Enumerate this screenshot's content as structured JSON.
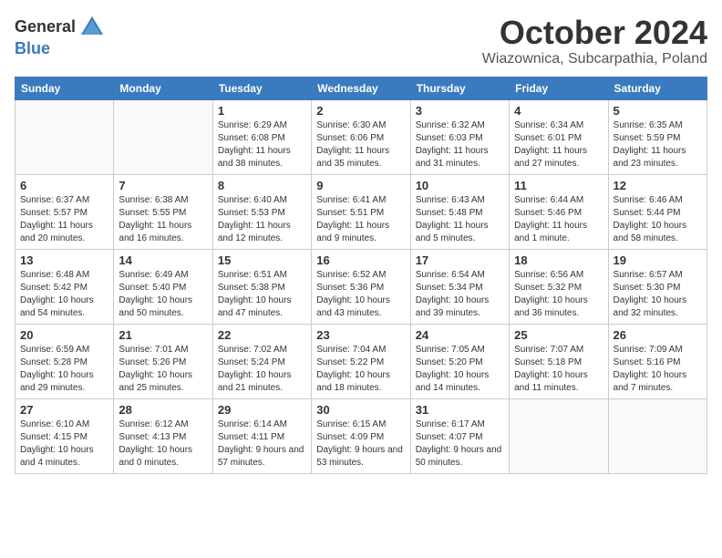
{
  "header": {
    "logo_general": "General",
    "logo_blue": "Blue",
    "month": "October 2024",
    "location": "Wiazownica, Subcarpathia, Poland"
  },
  "days_of_week": [
    "Sunday",
    "Monday",
    "Tuesday",
    "Wednesday",
    "Thursday",
    "Friday",
    "Saturday"
  ],
  "weeks": [
    [
      {
        "day": "",
        "info": ""
      },
      {
        "day": "",
        "info": ""
      },
      {
        "day": "1",
        "info": "Sunrise: 6:29 AM\nSunset: 6:08 PM\nDaylight: 11 hours and 38 minutes."
      },
      {
        "day": "2",
        "info": "Sunrise: 6:30 AM\nSunset: 6:06 PM\nDaylight: 11 hours and 35 minutes."
      },
      {
        "day": "3",
        "info": "Sunrise: 6:32 AM\nSunset: 6:03 PM\nDaylight: 11 hours and 31 minutes."
      },
      {
        "day": "4",
        "info": "Sunrise: 6:34 AM\nSunset: 6:01 PM\nDaylight: 11 hours and 27 minutes."
      },
      {
        "day": "5",
        "info": "Sunrise: 6:35 AM\nSunset: 5:59 PM\nDaylight: 11 hours and 23 minutes."
      }
    ],
    [
      {
        "day": "6",
        "info": "Sunrise: 6:37 AM\nSunset: 5:57 PM\nDaylight: 11 hours and 20 minutes."
      },
      {
        "day": "7",
        "info": "Sunrise: 6:38 AM\nSunset: 5:55 PM\nDaylight: 11 hours and 16 minutes."
      },
      {
        "day": "8",
        "info": "Sunrise: 6:40 AM\nSunset: 5:53 PM\nDaylight: 11 hours and 12 minutes."
      },
      {
        "day": "9",
        "info": "Sunrise: 6:41 AM\nSunset: 5:51 PM\nDaylight: 11 hours and 9 minutes."
      },
      {
        "day": "10",
        "info": "Sunrise: 6:43 AM\nSunset: 5:48 PM\nDaylight: 11 hours and 5 minutes."
      },
      {
        "day": "11",
        "info": "Sunrise: 6:44 AM\nSunset: 5:46 PM\nDaylight: 11 hours and 1 minute."
      },
      {
        "day": "12",
        "info": "Sunrise: 6:46 AM\nSunset: 5:44 PM\nDaylight: 10 hours and 58 minutes."
      }
    ],
    [
      {
        "day": "13",
        "info": "Sunrise: 6:48 AM\nSunset: 5:42 PM\nDaylight: 10 hours and 54 minutes."
      },
      {
        "day": "14",
        "info": "Sunrise: 6:49 AM\nSunset: 5:40 PM\nDaylight: 10 hours and 50 minutes."
      },
      {
        "day": "15",
        "info": "Sunrise: 6:51 AM\nSunset: 5:38 PM\nDaylight: 10 hours and 47 minutes."
      },
      {
        "day": "16",
        "info": "Sunrise: 6:52 AM\nSunset: 5:36 PM\nDaylight: 10 hours and 43 minutes."
      },
      {
        "day": "17",
        "info": "Sunrise: 6:54 AM\nSunset: 5:34 PM\nDaylight: 10 hours and 39 minutes."
      },
      {
        "day": "18",
        "info": "Sunrise: 6:56 AM\nSunset: 5:32 PM\nDaylight: 10 hours and 36 minutes."
      },
      {
        "day": "19",
        "info": "Sunrise: 6:57 AM\nSunset: 5:30 PM\nDaylight: 10 hours and 32 minutes."
      }
    ],
    [
      {
        "day": "20",
        "info": "Sunrise: 6:59 AM\nSunset: 5:28 PM\nDaylight: 10 hours and 29 minutes."
      },
      {
        "day": "21",
        "info": "Sunrise: 7:01 AM\nSunset: 5:26 PM\nDaylight: 10 hours and 25 minutes."
      },
      {
        "day": "22",
        "info": "Sunrise: 7:02 AM\nSunset: 5:24 PM\nDaylight: 10 hours and 21 minutes."
      },
      {
        "day": "23",
        "info": "Sunrise: 7:04 AM\nSunset: 5:22 PM\nDaylight: 10 hours and 18 minutes."
      },
      {
        "day": "24",
        "info": "Sunrise: 7:05 AM\nSunset: 5:20 PM\nDaylight: 10 hours and 14 minutes."
      },
      {
        "day": "25",
        "info": "Sunrise: 7:07 AM\nSunset: 5:18 PM\nDaylight: 10 hours and 11 minutes."
      },
      {
        "day": "26",
        "info": "Sunrise: 7:09 AM\nSunset: 5:16 PM\nDaylight: 10 hours and 7 minutes."
      }
    ],
    [
      {
        "day": "27",
        "info": "Sunrise: 6:10 AM\nSunset: 4:15 PM\nDaylight: 10 hours and 4 minutes."
      },
      {
        "day": "28",
        "info": "Sunrise: 6:12 AM\nSunset: 4:13 PM\nDaylight: 10 hours and 0 minutes."
      },
      {
        "day": "29",
        "info": "Sunrise: 6:14 AM\nSunset: 4:11 PM\nDaylight: 9 hours and 57 minutes."
      },
      {
        "day": "30",
        "info": "Sunrise: 6:15 AM\nSunset: 4:09 PM\nDaylight: 9 hours and 53 minutes."
      },
      {
        "day": "31",
        "info": "Sunrise: 6:17 AM\nSunset: 4:07 PM\nDaylight: 9 hours and 50 minutes."
      },
      {
        "day": "",
        "info": ""
      },
      {
        "day": "",
        "info": ""
      }
    ]
  ]
}
